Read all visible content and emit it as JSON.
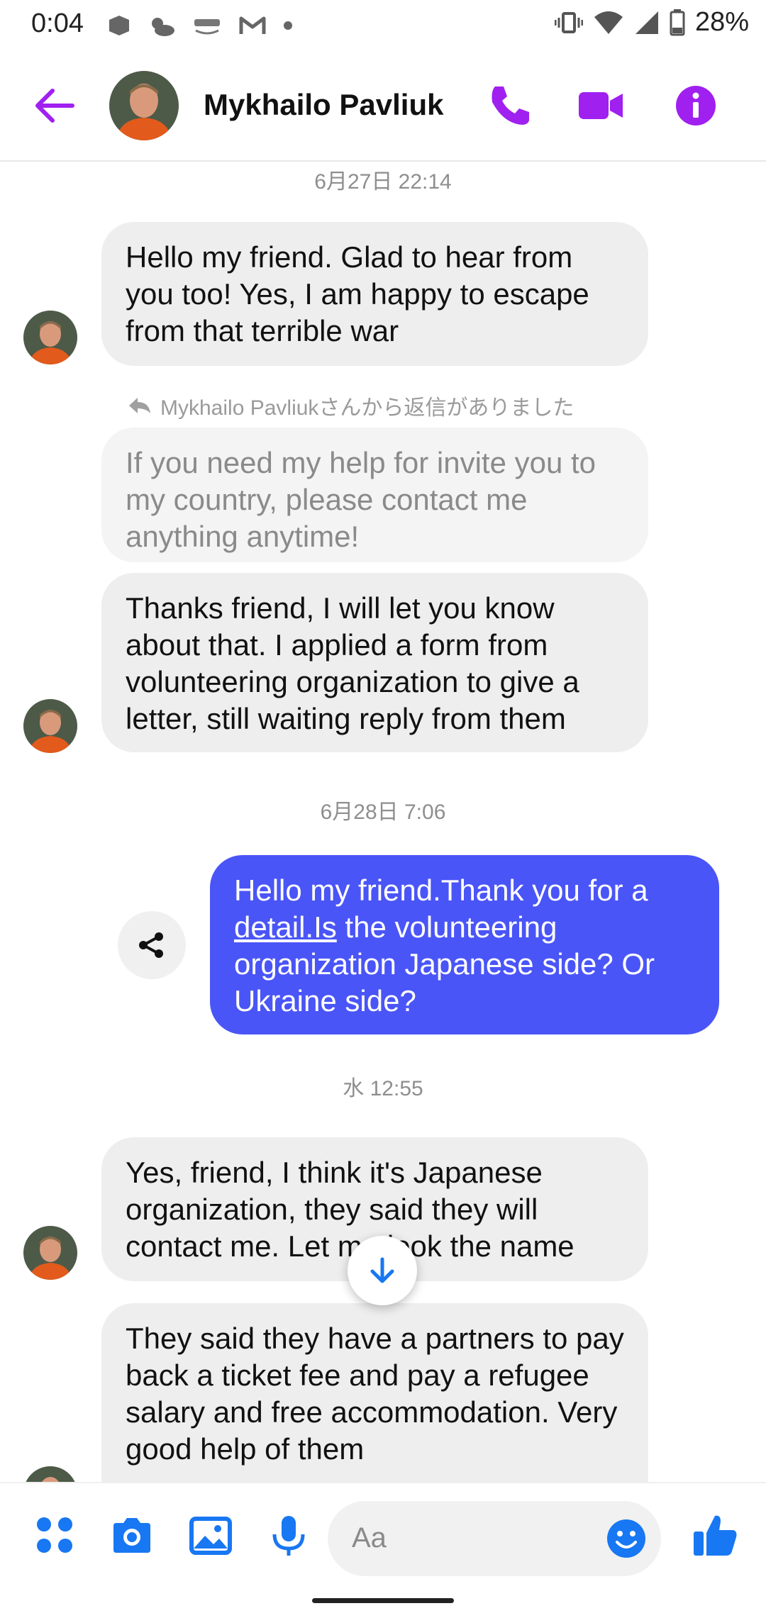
{
  "status_bar": {
    "time": "0:04",
    "battery": "28%",
    "left_icons": [
      "news-icon",
      "weather-icon",
      "photos-icon",
      "gmail-icon",
      "dot-icon"
    ],
    "right_icons": [
      "vibrate-icon",
      "wifi-icon",
      "signal-icon",
      "battery-icon"
    ]
  },
  "header": {
    "contact_name": "Mykhailo Pavliuk",
    "accent_color": "#a020f0"
  },
  "thread": {
    "timestamp_1": "6月27日 22:14",
    "msg_1": "Hello my friend. Glad to hear from you too! Yes, I am happy to escape from that terrible war",
    "reply_note": "Mykhailo Pavliukさんから返信がありました",
    "quoted_msg": "If you need my help for invite you to my country, please contact me anything anytime!",
    "msg_2": "Thanks friend, I will let you know about that.  I  applied a form from volunteering organization to give a letter, still waiting reply from them",
    "timestamp_2": "6月28日 7:06",
    "out_msg_prefix": "Hello my friend.Thank you for a ",
    "out_msg_link": "detail.Is",
    "out_msg_suffix": " the volunteering organization Japanese side? Or Ukraine side?",
    "timestamp_3": "水 12:55",
    "msg_3": "Yes, friend, I think it's Japanese organization, they said they will contact me. Let me look the name",
    "msg_4": "They said they have a partners to pay back a ticket fee and pay a refugee salary and free accommodation. Very good help of them"
  },
  "composer": {
    "placeholder": "Aa",
    "icons": [
      "apps-icon",
      "camera-icon",
      "gallery-icon",
      "microphone-icon",
      "emoji-icon",
      "like-icon"
    ]
  },
  "colors": {
    "accent_purple": "#a020f0",
    "outgoing_bubble": "#4a55f7",
    "composer_blue": "#1877f2"
  }
}
